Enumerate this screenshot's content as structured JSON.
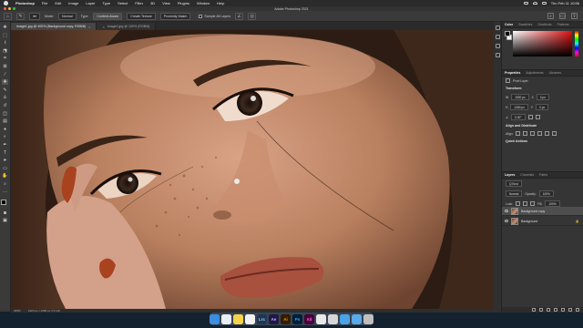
{
  "menubar": {
    "app_name": "Photoshop",
    "items": [
      "File",
      "Edit",
      "Image",
      "Layer",
      "Type",
      "Select",
      "Filter",
      "3D",
      "View",
      "Plugins",
      "Window",
      "Help"
    ],
    "clock": "Thu Feb 11 10:56"
  },
  "titlebar": {
    "title": "Adobe Photoshop 2021"
  },
  "options": {
    "mode_label": "Mode:",
    "mode_value": "Normal",
    "type_label": "Type:",
    "type_values": [
      "Content-Aware",
      "Create Texture",
      "Proximity Match"
    ],
    "sample_label": "Sample All Layers"
  },
  "tabs": [
    {
      "label": "image1.jpg @ 400% (Background copy, RGB/8)"
    },
    {
      "label": "image2.jpg @ 100% (RGB/8)"
    }
  ],
  "status": {
    "zoom": "400%",
    "doc_info": "1920 px x 1280 px (72 ppi)"
  },
  "panels": {
    "color_tabs": [
      "Color",
      "Swatches",
      "Gradients",
      "Patterns"
    ],
    "props_tabs": [
      "Properties",
      "Adjustments",
      "Libraries"
    ],
    "pixel_layer_label": "Pixel Layer",
    "transform_label": "Transform",
    "w_value": "1920 px",
    "h_value": "1280 px",
    "x_value": "0 px",
    "y_value": "0 px",
    "angle_value": "0.00°",
    "align_label": "Align and Distribute",
    "align_sub": "Align:",
    "quick_actions_label": "Quick Actions",
    "layers_tabs": [
      "Layers",
      "Channels",
      "Paths"
    ],
    "kind_label": "Q Kind",
    "blend_mode": "Normal",
    "opacity_label": "Opacity:",
    "opacity_value": "100%",
    "lock_label": "Lock:",
    "fill_label": "Fill:",
    "fill_value": "100%",
    "layers": [
      {
        "name": "Background copy"
      },
      {
        "name": "Background"
      }
    ]
  },
  "dock": {
    "apps": [
      {
        "name": "Finder",
        "glyph": "",
        "bg": "#3b8de0",
        "fg": "#ffffff"
      },
      {
        "name": "Safari",
        "glyph": "",
        "bg": "#e8eef5",
        "fg": "#1a6fd1"
      },
      {
        "name": "Notes",
        "glyph": "",
        "bg": "#f5d24a",
        "fg": "#5a4a00"
      },
      {
        "name": "Photos",
        "glyph": "",
        "bg": "#f2f2f2",
        "fg": "#e0457b"
      },
      {
        "name": "Lightroom",
        "glyph": "Lrc",
        "bg": "#1f3653",
        "fg": "#a6d0f5"
      },
      {
        "name": "After Effects",
        "glyph": "Ae",
        "bg": "#1f1844",
        "fg": "#c8a8ff"
      },
      {
        "name": "Illustrator",
        "glyph": "Ai",
        "bg": "#331c00",
        "fg": "#ff9a00"
      },
      {
        "name": "Photoshop",
        "glyph": "Ps",
        "bg": "#001e36",
        "fg": "#31a8ff"
      },
      {
        "name": "XD",
        "glyph": "Xd",
        "bg": "#470137",
        "fg": "#ff61f6"
      },
      {
        "name": "Camera",
        "glyph": "",
        "bg": "#e9e9e9",
        "fg": "#333"
      },
      {
        "name": "Screenshot",
        "glyph": "",
        "bg": "#d6d6d6",
        "fg": "#555"
      },
      {
        "name": "Folder",
        "glyph": "",
        "bg": "#4aa3e6",
        "fg": "#fff"
      },
      {
        "name": "Downloads",
        "glyph": "",
        "bg": "#5aa9e8",
        "fg": "#fff"
      },
      {
        "name": "Trash",
        "glyph": "",
        "bg": "#bfbfbf",
        "fg": "#555"
      }
    ]
  },
  "colors": {
    "chrome_dark": "#2b2b2b",
    "chrome_mid": "#3a3a3a",
    "panel": "#353535",
    "accent_red": "#e01010"
  }
}
